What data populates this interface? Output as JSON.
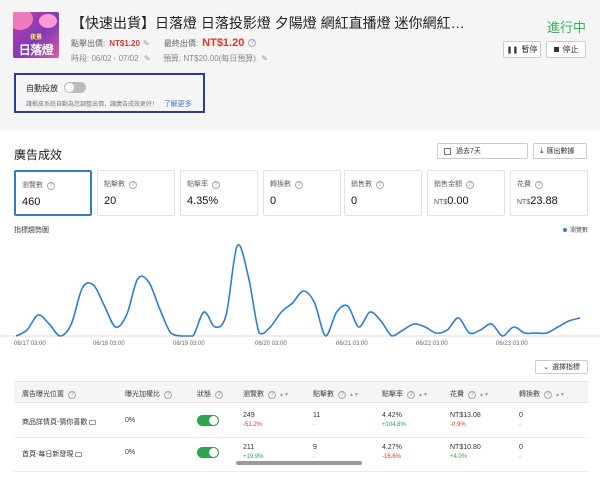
{
  "header": {
    "title": "【快速出貨】日落燈 日落投影燈 夕陽燈 網紅直播燈 迷你網紅燈 氣氛燈 投...",
    "status": "進行中",
    "thumb_text_small": "夜景",
    "thumb_text_big": "日落燈",
    "bid_label": "點擊出價:",
    "bid_value": "NT$1.20",
    "final_bid_label": "最終出價:",
    "final_bid_value": "NT$1.20",
    "date_label": "時段: 06/02 - 07/02",
    "budget_label": "預算: NT$20.00(每日預算)",
    "pause_label": "暫停",
    "stop_label": "停止"
  },
  "auto_bid": {
    "label": "自動投放",
    "enabled": false,
    "description": "讓蝦皮系統自動為您調整出價，讓廣告成效更好！",
    "link": "了解更多"
  },
  "performance": {
    "title": "廣告成效",
    "period": "過去7天",
    "export": "匯出數據",
    "trend_label": "指標趨勢圖",
    "legend": "瀏覽數",
    "pick_metrics": "選擇指標",
    "cards": [
      {
        "label": "瀏覽數",
        "value": "460",
        "currency": ""
      },
      {
        "label": "點擊數",
        "value": "20",
        "currency": ""
      },
      {
        "label": "點擊率",
        "value": "4.35%",
        "currency": ""
      },
      {
        "label": "轉換數",
        "value": "0",
        "currency": ""
      },
      {
        "label": "銷售數",
        "value": "0",
        "currency": ""
      },
      {
        "label": "銷售金額",
        "value": "0.00",
        "currency": "NT$"
      },
      {
        "label": "花費",
        "value": "23.88",
        "currency": "NT$"
      }
    ]
  },
  "chart_data": {
    "type": "line",
    "x": [
      "06/17 03:00",
      "06/18 03:00",
      "06/19 03:00",
      "06/20 03:00",
      "06/21 03:00",
      "06/22 03:00",
      "06/23 03:00"
    ],
    "series": [
      {
        "name": "瀏覽數",
        "color": "#2e7dd1",
        "values": [
          0,
          2,
          7,
          4,
          0,
          4,
          16,
          17,
          10,
          3,
          7,
          19,
          18,
          9,
          1,
          0,
          0,
          8,
          3,
          7,
          30,
          20,
          1,
          3,
          8,
          11,
          15,
          11,
          0,
          8,
          10,
          3,
          8,
          5,
          0,
          2,
          4,
          3,
          1,
          2,
          6,
          1,
          2,
          4,
          0,
          3,
          1,
          1,
          1,
          3,
          5,
          6
        ]
      }
    ],
    "ylim": [
      0,
      32
    ],
    "grid": false
  },
  "table": {
    "headers": [
      "廣告曝光位置",
      "曝光加權比",
      "狀態",
      "瀏覽數",
      "點擊數",
      "點擊率",
      "花費",
      "轉換數"
    ],
    "rows": [
      {
        "placement": "商品詳情頁-猜你喜歡",
        "weight": "0%",
        "enabled": true,
        "views": "249",
        "views_change": "-51.2%",
        "clicks": "11",
        "clicks_change": "-",
        "ctr": "4.42%",
        "ctr_change": "+104.8%",
        "spend": "NT$13.08",
        "spend_change": "-0.9%",
        "conversions": "0",
        "conversions_change": "-"
      },
      {
        "placement": "首頁-每日新發現",
        "weight": "0%",
        "enabled": true,
        "views": "211",
        "views_change": "+19.9%",
        "clicks": "9",
        "clicks_change": "-",
        "ctr": "4.27%",
        "ctr_change": "-16.6%",
        "spend": "NT$10.80",
        "spend_change": "+4.0%",
        "conversions": "0",
        "conversions_change": "-"
      }
    ]
  }
}
